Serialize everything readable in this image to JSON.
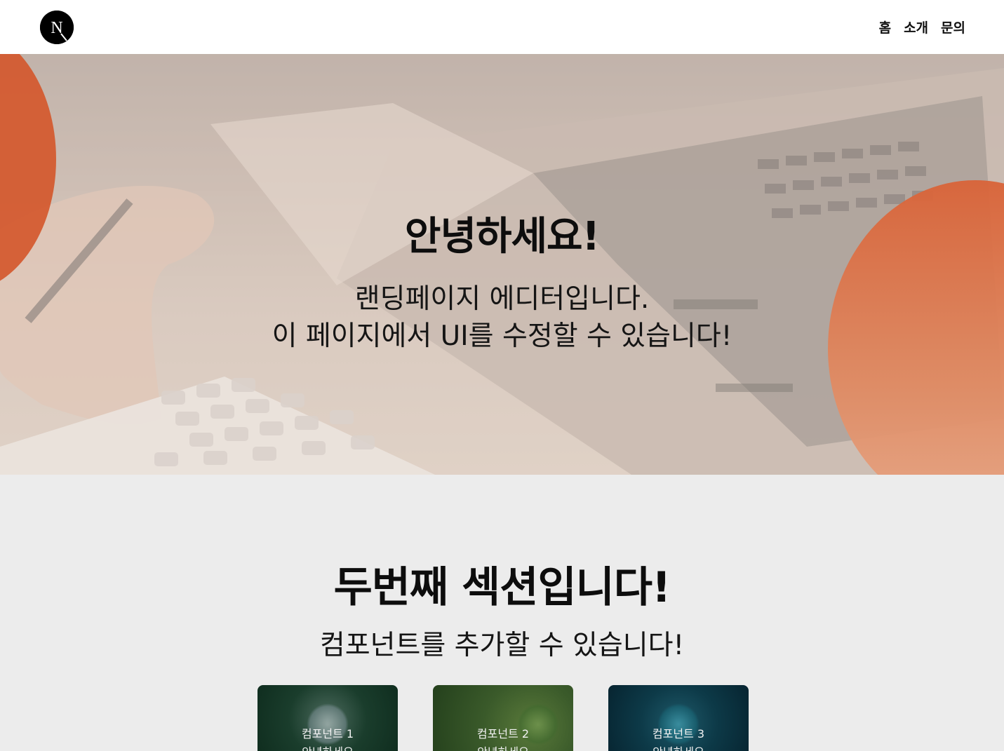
{
  "header": {
    "logo_letter": "N",
    "nav": [
      "홈",
      "소개",
      "문의"
    ]
  },
  "hero": {
    "title": "안녕하세요!",
    "subtitle_line1": "랜딩페이지 에디터입니다.",
    "subtitle_line2": "이 페이지에서 UI를 수정할 수 있습니다!"
  },
  "section2": {
    "title": "두번째 섹션입니다!",
    "subtitle": "컴포넌트를 추가할 수 있습니다!",
    "cards": [
      {
        "title": "컴포넌트 1",
        "text": "안녕하세요"
      },
      {
        "title": "컴포넌트 2",
        "text": "안녕하세요"
      },
      {
        "title": "컴포넌트 3",
        "text": "안녕하세요"
      }
    ]
  },
  "colors": {
    "accent_orange": "#d4582c",
    "section_bg": "#ececec",
    "header_bg": "#ffffff"
  },
  "icons": {
    "logo": "nextjs-logo-icon"
  }
}
